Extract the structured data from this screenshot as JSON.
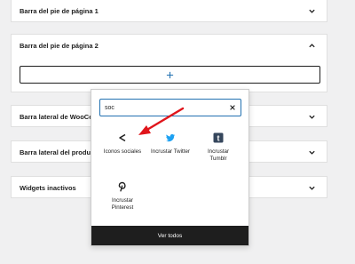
{
  "panels": {
    "footer1": "Barra del pie de página 1",
    "footer2": "Barra del pie de página 2",
    "woo": "Barra lateral de WooComm",
    "product": "Barra lateral del producto",
    "inactive": "Widgets inactivos"
  },
  "inserter": {
    "search_value": "soc",
    "blocks": {
      "social": "Iconos sociales",
      "twitter": "Incrustar Twitter",
      "tumblr": "Incrustar Tumblr",
      "pinterest": "Incrustar Pinterest"
    },
    "view_all": "Ver todos"
  },
  "colors": {
    "accent": "#2271b1",
    "twitter": "#1da1f2",
    "tumblr": "#35465c",
    "arrow": "#e0151b",
    "dark": "#1e1e1e"
  },
  "icons": [
    "chevron-down-icon",
    "chevron-up-icon",
    "plus-icon",
    "close-icon",
    "share-icon",
    "twitter-icon",
    "tumblr-icon",
    "pinterest-icon"
  ]
}
